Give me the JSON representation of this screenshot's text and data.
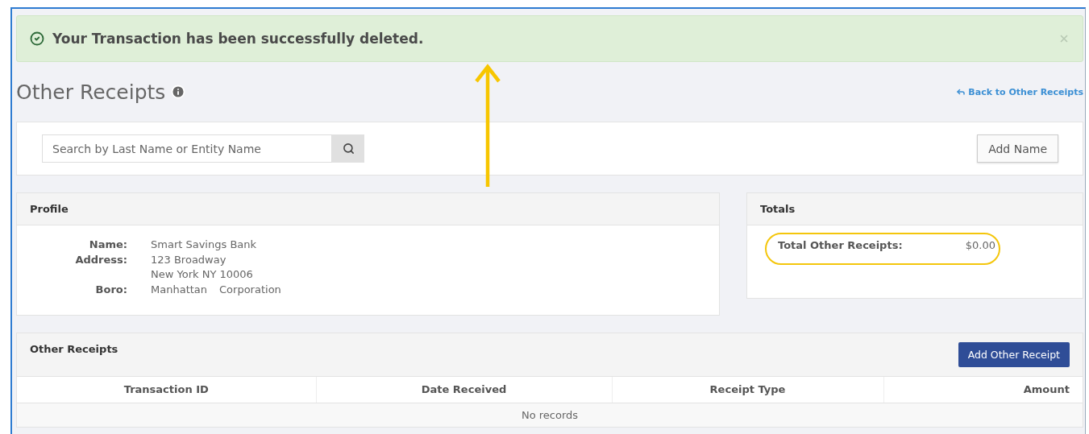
{
  "alert": {
    "message": "Your Transaction has been successfully deleted."
  },
  "page": {
    "title": "Other Receipts",
    "back_link": "Back to Other Receipts"
  },
  "search": {
    "placeholder": "Search by Last Name or Entity Name",
    "button": "Add Name"
  },
  "profile": {
    "title": "Profile",
    "fields": [
      {
        "kind": "stacked",
        "label": "Name:",
        "lines": [
          "Smart Savings Bank"
        ]
      },
      {
        "kind": "stacked",
        "label": "Address:",
        "lines": [
          "123 Broadway",
          "New York NY 10006"
        ]
      },
      {
        "kind": "inline",
        "label": "Boro:",
        "lines": [
          "Manhattan",
          "Corporation"
        ]
      }
    ]
  },
  "totals": {
    "title": "Totals",
    "label": "Total Other Receipts:",
    "value": "$0.00"
  },
  "receipts": {
    "title": "Other Receipts",
    "button": "Add Other Receipt",
    "columns": [
      "Transaction ID",
      "Date Received",
      "Receipt Type",
      "Amount"
    ],
    "empty": "No records"
  }
}
